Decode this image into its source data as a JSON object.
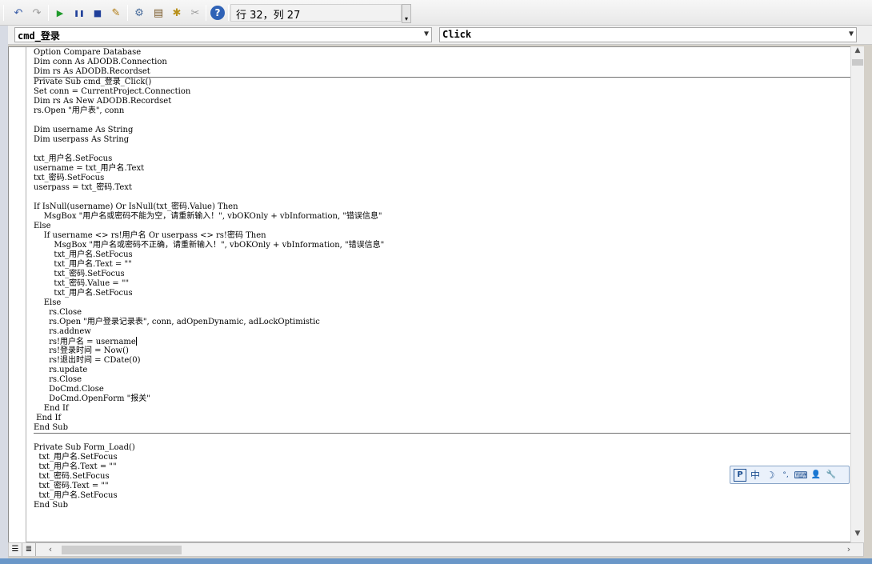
{
  "toolbar": {
    "position_text": "行 32，列 27",
    "buttons": [
      {
        "name": "undo-icon",
        "glyph": "↶"
      },
      {
        "name": "redo-icon",
        "glyph": "↷"
      },
      {
        "name": "run-icon",
        "glyph": "▶"
      },
      {
        "name": "break-icon",
        "glyph": "❚❚"
      },
      {
        "name": "reset-icon",
        "glyph": "■"
      },
      {
        "name": "design-mode-icon",
        "glyph": "✎"
      },
      {
        "name": "project-explorer-icon",
        "glyph": "⚙"
      },
      {
        "name": "properties-window-icon",
        "glyph": "▤"
      },
      {
        "name": "object-browser-icon",
        "glyph": "✱"
      },
      {
        "name": "toolbox-icon",
        "glyph": "✂"
      },
      {
        "name": "help-icon",
        "glyph": "?"
      }
    ]
  },
  "object_combo": {
    "value": "cmd_登录"
  },
  "procedure_combo": {
    "value": "Click"
  },
  "code": {
    "declarations": [
      "Option Compare Database",
      "Dim conn As ADODB.Connection",
      "Dim rs As ADODB.Recordset"
    ],
    "login_click": [
      "Private Sub cmd_登录_Click()",
      "Set conn = CurrentProject.Connection",
      "Dim rs As New ADODB.Recordset",
      "rs.Open \"用户表\", conn",
      "",
      "Dim username As String",
      "Dim userpass As String",
      "",
      "txt_用户名.SetFocus",
      "username = txt_用户名.Text",
      "txt_密码.SetFocus",
      "userpass = txt_密码.Text",
      "",
      "If IsNull(username) Or IsNull(txt_密码.Value) Then",
      "    MsgBox \"用户名或密码不能为空，请重新输入！\", vbOKOnly + vbInformation, \"错误信息\"",
      "Else",
      "    If username <> rs!用户名 Or userpass <> rs!密码 Then",
      "        MsgBox \"用户名或密码不正确，请重新输入！\", vbOKOnly + vbInformation, \"错误信息\"",
      "        txt_用户名.SetFocus",
      "        txt_用户名.Text = \"\"",
      "        txt_密码.SetFocus",
      "        txt_密码.Value = \"\"",
      "        txt_用户名.SetFocus",
      "    Else",
      "      rs.Close",
      "      rs.Open \"用户登录记录表\", conn, adOpenDynamic, adLockOptimistic",
      "      rs.addnew",
      "      rs!用户名 = username",
      "      rs!登录时间 = Now()",
      "      rs!退出时间 = CDate(0)",
      "      rs.update",
      "      rs.Close",
      "      DoCmd.Close",
      "      DoCmd.OpenForm \"报关\"",
      "    End If",
      " End If",
      "End Sub"
    ],
    "form_load": [
      "",
      "Private Sub Form_Load()",
      "  txt_用户名.SetFocus",
      "  txt_用户名.Text = \"\"",
      "  txt_密码.SetFocus",
      "  txt_密码.Text = \"\"",
      "  txt_用户名.SetFocus",
      "End Sub"
    ]
  },
  "ime": {
    "items": [
      {
        "name": "ime-logo-icon",
        "glyph": "P"
      },
      {
        "name": "ime-chinese-mode",
        "glyph": "中"
      },
      {
        "name": "ime-halfwidth-icon",
        "glyph": "☽"
      },
      {
        "name": "ime-punctuation-icon",
        "glyph": "°,"
      },
      {
        "name": "ime-keyboard-icon",
        "glyph": "⌨"
      },
      {
        "name": "ime-user-icon",
        "glyph": "👤"
      },
      {
        "name": "ime-settings-icon",
        "glyph": "🔧"
      }
    ]
  }
}
